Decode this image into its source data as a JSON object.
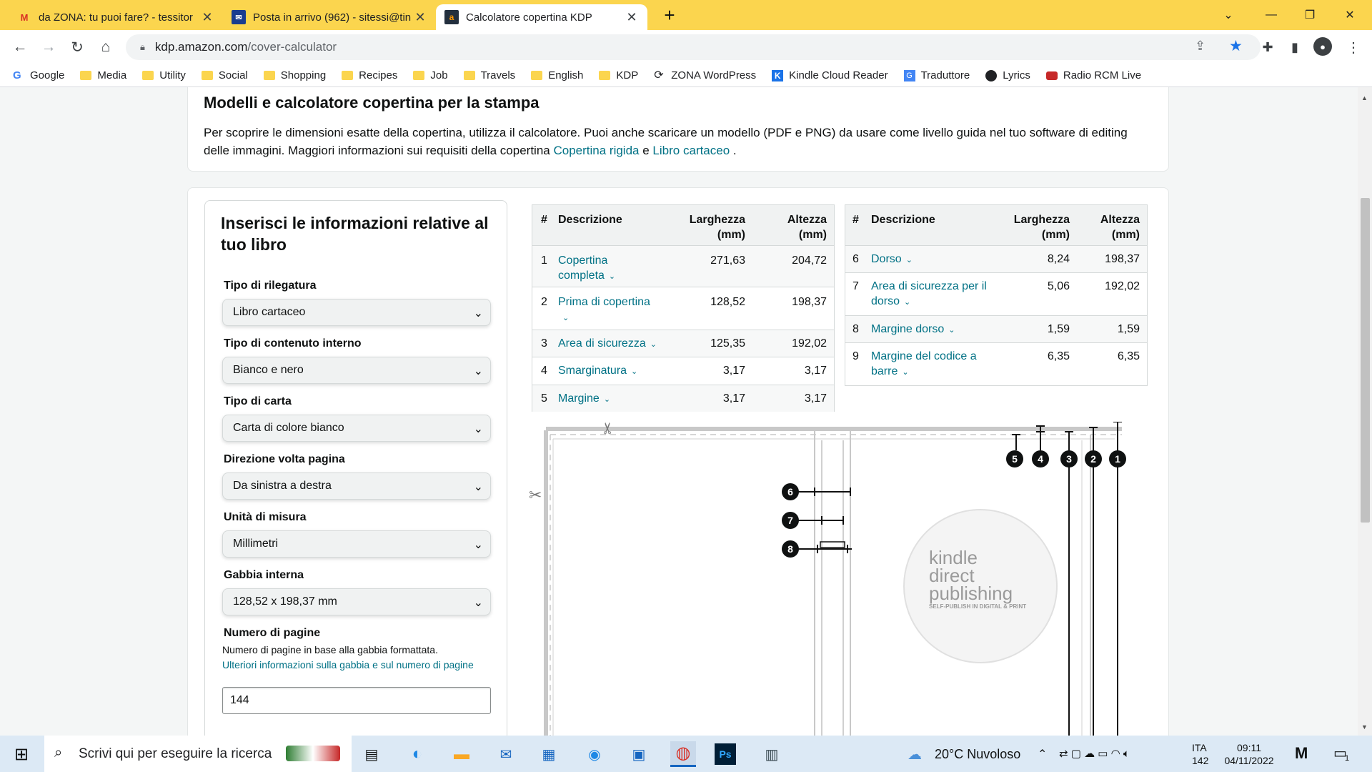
{
  "browser": {
    "tabs": [
      {
        "favicon": "gmail-icon",
        "title": "da ZONA: tu puoi fare? - tessitor"
      },
      {
        "favicon": "mail-icon",
        "title": "Posta in arrivo (962) - sitessi@tin"
      },
      {
        "favicon": "amazon-icon",
        "title": "Calcolatore copertina KDP"
      }
    ],
    "new_tab": "+",
    "url_host": "kdp.amazon.com",
    "url_path": "/cover-calculator",
    "bookmarks": [
      {
        "icon": "google-icon",
        "label": "Google"
      },
      {
        "icon": "folder-icon",
        "label": "Media"
      },
      {
        "icon": "folder-icon",
        "label": "Utility"
      },
      {
        "icon": "folder-icon",
        "label": "Social"
      },
      {
        "icon": "folder-icon",
        "label": "Shopping"
      },
      {
        "icon": "folder-icon",
        "label": "Recipes"
      },
      {
        "icon": "folder-icon",
        "label": "Job"
      },
      {
        "icon": "folder-icon",
        "label": "Travels"
      },
      {
        "icon": "folder-icon",
        "label": "English"
      },
      {
        "icon": "folder-icon",
        "label": "KDP"
      },
      {
        "icon": "wordpress-icon",
        "label": "ZONA WordPress"
      },
      {
        "icon": "kindle-icon",
        "label": "Kindle Cloud Reader"
      },
      {
        "icon": "translate-icon",
        "label": "Traduttore"
      },
      {
        "icon": "globe-icon",
        "label": "Lyrics"
      },
      {
        "icon": "radio-icon",
        "label": "Radio RCM Live"
      }
    ]
  },
  "intro": {
    "title": "Modelli e calcolatore copertina per la stampa",
    "text": "Per scoprire le dimensioni esatte della copertina, utilizza il calcolatore. Puoi anche scaricare un modello (PDF e PNG) da usare come livello guida nel tuo software di editing delle immagini. Maggiori informazioni sui requisiti della copertina",
    "link1": "Copertina rigida",
    "and": "e",
    "link2": "Libro cartaceo",
    "end": "."
  },
  "form": {
    "title": "Inserisci le informazioni relative al tuo libro",
    "fields": [
      {
        "label": "Tipo di rilegatura",
        "value": "Libro cartaceo"
      },
      {
        "label": "Tipo di contenuto interno",
        "value": "Bianco e nero"
      },
      {
        "label": "Tipo di carta",
        "value": "Carta di colore bianco"
      },
      {
        "label": "Direzione volta pagina",
        "value": "Da sinistra a destra"
      },
      {
        "label": "Unità di misura",
        "value": "Millimetri"
      },
      {
        "label": "Gabbia interna",
        "value": "128,52 x 198,37 mm"
      }
    ],
    "pages_label": "Numero di pagine",
    "pages_help": "Numero di pagine in base alla gabbia formattata.",
    "pages_link": "Ulteriori informazioni sulla gabbia e sul numero di pagine",
    "pages_value": "144"
  },
  "table_headers": {
    "num": "#",
    "desc": "Descrizione",
    "width": "Larghezza (mm)",
    "height": "Altezza (mm)"
  },
  "table1": [
    {
      "n": "1",
      "desc": "Copertina completa",
      "w": "271,63",
      "h": "204,72"
    },
    {
      "n": "2",
      "desc": "Prima di copertina",
      "w": "128,52",
      "h": "198,37"
    },
    {
      "n": "3",
      "desc": "Area di sicurezza",
      "w": "125,35",
      "h": "192,02"
    },
    {
      "n": "4",
      "desc": "Smarginatura",
      "w": "3,17",
      "h": "3,17"
    },
    {
      "n": "5",
      "desc": "Margine",
      "w": "3,17",
      "h": "3,17"
    }
  ],
  "table2": [
    {
      "n": "6",
      "desc": "Dorso",
      "w": "8,24",
      "h": "198,37"
    },
    {
      "n": "7",
      "desc": "Area di sicurezza per il dorso",
      "w": "5,06",
      "h": "192,02"
    },
    {
      "n": "8",
      "desc": "Margine dorso",
      "w": "1,59",
      "h": "1,59"
    },
    {
      "n": "9",
      "desc": "Margine del codice a barre",
      "w": "6,35",
      "h": "6,35"
    }
  ],
  "diagram": {
    "badges": [
      "1",
      "2",
      "3",
      "4",
      "5",
      "6",
      "7",
      "8"
    ],
    "logo_line1": "kindle",
    "logo_line2": "direct",
    "logo_line3": "publishing",
    "logo_tagline": "SELF-PUBLISH IN DIGITAL & PRINT"
  },
  "taskbar": {
    "search_placeholder": "Scrivi qui per eseguire la ricerca",
    "weather": "20°C  Nuvoloso",
    "lang": "ITA",
    "lang_sub": "142",
    "time": "09:11",
    "date": "04/11/2022",
    "notif": "1"
  },
  "colors": {
    "tabstrip": "#fbd54e",
    "link": "#007185",
    "page_bg": "#f4f6f6"
  }
}
